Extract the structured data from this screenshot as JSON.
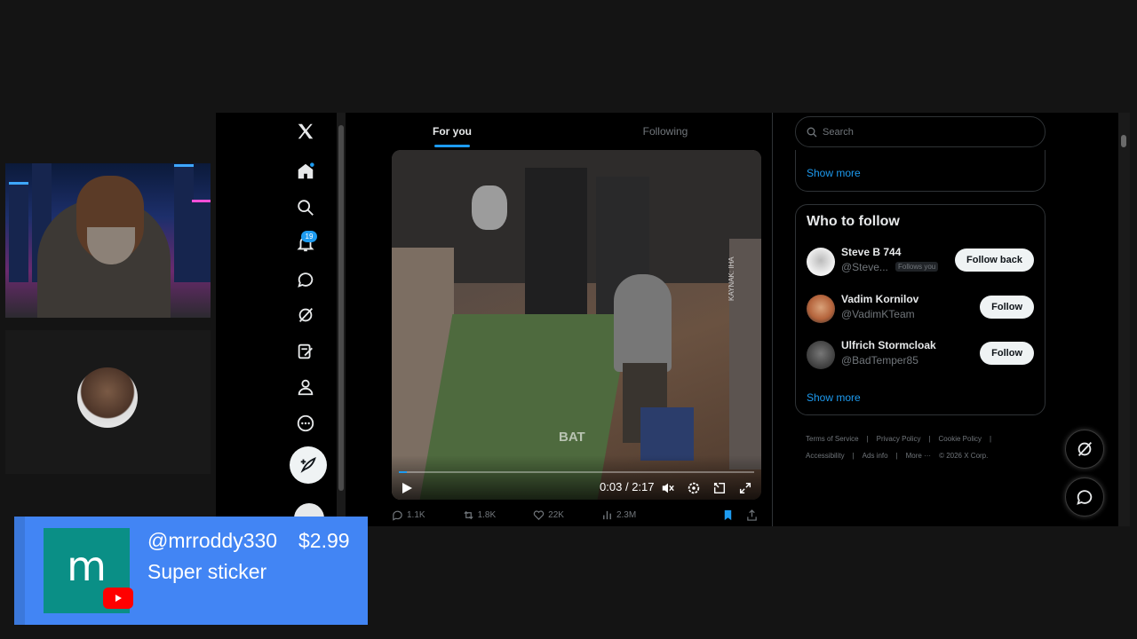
{
  "x_app": {
    "nav": {
      "notifications_badge": "19",
      "items": [
        "x-logo-icon",
        "home-icon",
        "search-icon",
        "notifications-icon",
        "messages-icon",
        "grok-icon",
        "drafts-icon",
        "profile-icon",
        "more-icon",
        "post-icon"
      ]
    },
    "tabs": [
      "For you",
      "Following"
    ],
    "active_tab": "For you",
    "video": {
      "current_time": "0:03",
      "separator": "/",
      "duration": "2:17",
      "progress_fraction": 0.022,
      "watermark": "BAT",
      "overlay_text": "KAYNAK: IHA"
    },
    "post_actions": {
      "replies": "1.1K",
      "reposts": "1.8K",
      "likes": "22K",
      "views": "2.3M"
    },
    "search": {
      "placeholder": "Search"
    },
    "trends": {
      "show_more": "Show more"
    },
    "who_to_follow": {
      "title": "Who to follow",
      "accounts": [
        {
          "name": "Steve B 744",
          "handle": "@Steve...",
          "tag": "Follows you",
          "button": "Follow back"
        },
        {
          "name": "Vadim Kornilov",
          "handle": "@VadimKTeam",
          "button": "Follow"
        },
        {
          "name": "Ulfrich Stormcloak",
          "handle": "@BadTemper85",
          "button": "Follow"
        }
      ],
      "show_more": "Show more"
    },
    "footer": {
      "links": [
        "Terms of Service",
        "|",
        "Privacy Policy",
        "|",
        "Cookie Policy",
        "|",
        "Accessibility",
        "|",
        "Ads info",
        "|",
        "More ···",
        "© 2026 X Corp."
      ]
    }
  },
  "super_sticker": {
    "username": "@mrroddy330",
    "amount": "$2.99",
    "label": "Super sticker",
    "avatar_letter": "m"
  },
  "colors": {
    "accent": "#1d9bf0",
    "sticker_bg": "#4285f4",
    "sticker_avatar": "#0a8f86",
    "youtube_red": "#ff0000"
  }
}
